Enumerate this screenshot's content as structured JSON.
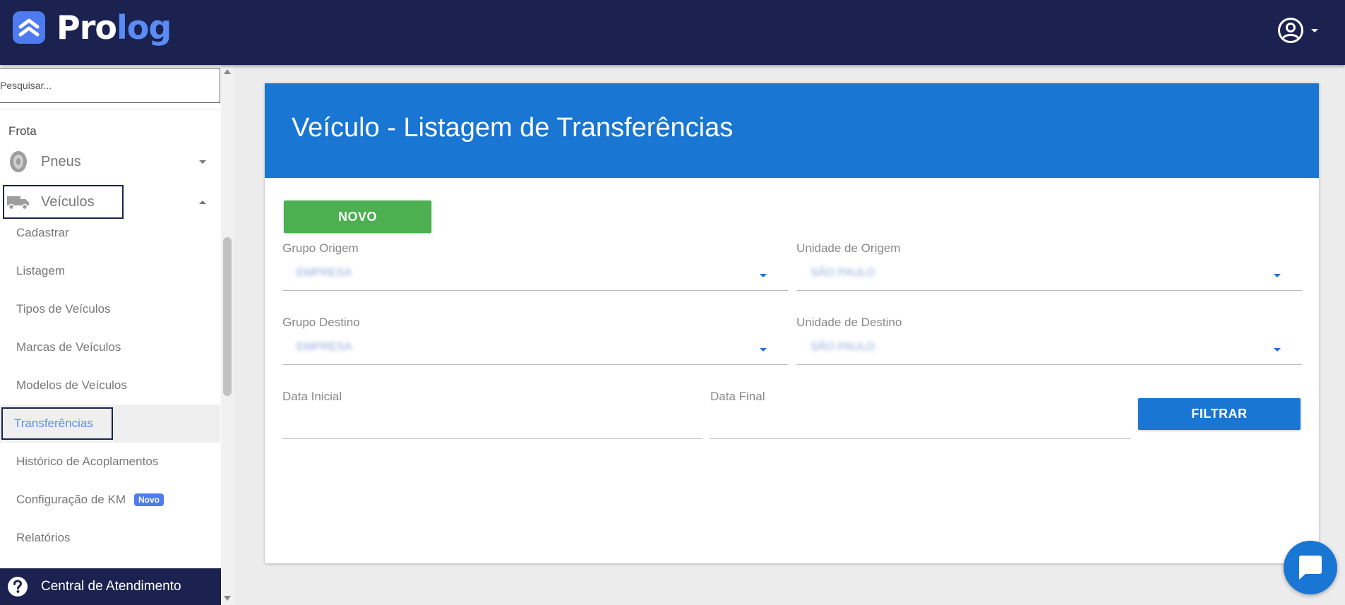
{
  "brand": {
    "name_part1": "Pro",
    "name_part2": "log",
    "accent": "#5b8cf5",
    "header_bg": "#1b224f"
  },
  "header": {
    "account_icon": "account-circle-icon"
  },
  "sidebar": {
    "search_placeholder": "Pesquisar...",
    "section_label": "Frota",
    "parents": [
      {
        "label": "Pneus",
        "icon": "tire-icon",
        "expanded": false
      },
      {
        "label": "Veículos",
        "icon": "truck-icon",
        "expanded": true
      }
    ],
    "sub_items": [
      {
        "label": "Cadastrar"
      },
      {
        "label": "Listagem"
      },
      {
        "label": "Tipos de Veículos"
      },
      {
        "label": "Marcas de Veículos"
      },
      {
        "label": "Modelos de Veículos"
      },
      {
        "label": "Transferências",
        "active": true
      },
      {
        "label": "Histórico de Acoplamentos"
      },
      {
        "label": "Configuração de KM",
        "badge": "Novo"
      },
      {
        "label": "Relatórios"
      }
    ],
    "help_label": "Central de Atendimento"
  },
  "main": {
    "title": "Veículo - Listagem de Transferências",
    "new_button": "NOVO",
    "filters": {
      "grupo_origem": {
        "label": "Grupo Origem",
        "value": "EMPRESA"
      },
      "unidade_origem": {
        "label": "Unidade de Origem",
        "value": "SÃO PAULO"
      },
      "grupo_destino": {
        "label": "Grupo Destino",
        "value": "EMPRESA"
      },
      "unidade_destino": {
        "label": "Unidade de Destino",
        "value": "SÃO PAULO"
      },
      "data_inicial": {
        "label": "Data Inicial"
      },
      "data_final": {
        "label": "Data Final"
      }
    },
    "filter_button": "FILTRAR"
  },
  "colors": {
    "primary": "#1976d2",
    "success": "#4caf50"
  }
}
